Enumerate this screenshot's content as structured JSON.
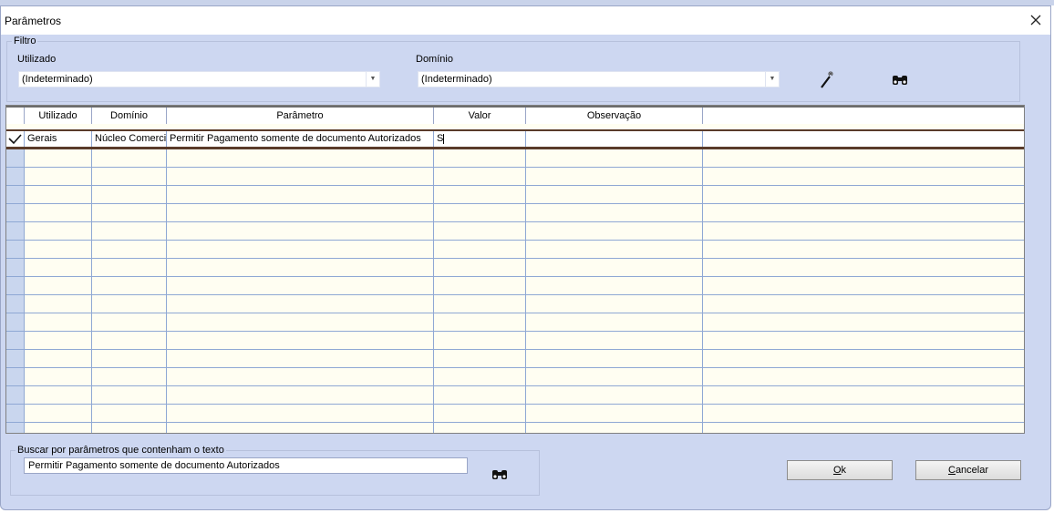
{
  "window": {
    "title": "Parâmetros"
  },
  "filter": {
    "legend": "Filtro",
    "utilizado_label": "Utilizado",
    "utilizado_value": "(Indeterminado)",
    "dominio_label": "Domínio",
    "dominio_value": "(Indeterminado)"
  },
  "grid": {
    "columns": [
      "Utilizado",
      "Domínio",
      "Parâmetro",
      "Valor",
      "Observação"
    ],
    "rows": [
      {
        "utilizado": "Gerais",
        "dominio": "Núcleo Comerci",
        "parametro": "Permitir Pagamento somente de documento Autorizados",
        "valor": "S",
        "observacao": ""
      }
    ]
  },
  "search": {
    "legend": "Buscar por parâmetros que contenham o texto",
    "value": "Permitir Pagamento somente de documento Autorizados"
  },
  "buttons": {
    "ok_key": "O",
    "ok_rest": "k",
    "cancel_key": "C",
    "cancel_rest": "ancelar"
  },
  "colors": {
    "window_bg": "#cdd7f1",
    "grid_bg": "#fffef2",
    "row_indicator": "#c9d6ee"
  }
}
